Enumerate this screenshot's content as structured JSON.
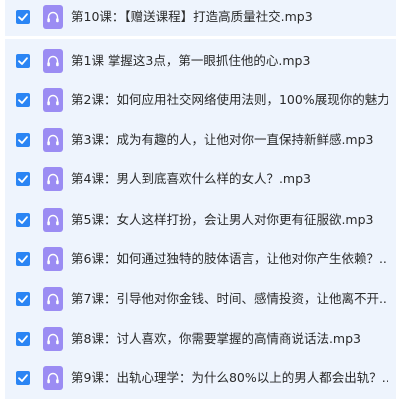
{
  "file_list": {
    "items": [
      {
        "name": "第10课：【赠送课程】打造高质量社交.mp3",
        "checked": true,
        "icon": "audio-file-icon"
      },
      {
        "name": "第1课 掌握这3点，第一眼抓住他的心.mp3",
        "checked": true,
        "icon": "audio-file-icon"
      },
      {
        "name": "第2课：如何应用社交网络使用法则，100%展现你的魅力...",
        "checked": true,
        "icon": "audio-file-icon"
      },
      {
        "name": "第3课：成为有趣的人，让他对你一直保持新鲜感.mp3",
        "checked": true,
        "icon": "audio-file-icon"
      },
      {
        "name": "第4课：男人到底喜欢什么样的女人？.mp3",
        "checked": true,
        "icon": "audio-file-icon"
      },
      {
        "name": "第5课：女人这样打扮，会让男人对你更有征服欲.mp3",
        "checked": true,
        "icon": "audio-file-icon"
      },
      {
        "name": "第6课：如何通过独特的肢体语言，让他对你产生依赖？....",
        "checked": true,
        "icon": "audio-file-icon"
      },
      {
        "name": "第7课：引导他对你金钱、时间、感情投资，让他离不开...",
        "checked": true,
        "icon": "audio-file-icon"
      },
      {
        "name": "第8课：讨人喜欢，你需要掌握的高情商说话法.mp3",
        "checked": true,
        "icon": "audio-file-icon"
      },
      {
        "name": "第9课：出轨心理学：为什么80%以上的男人都会出轨？....",
        "checked": true,
        "icon": "audio-file-icon"
      }
    ]
  },
  "colors": {
    "row_background": "#eef4fd",
    "checkbox": "#2b85f4",
    "audio_icon": "#9b8cf3"
  }
}
